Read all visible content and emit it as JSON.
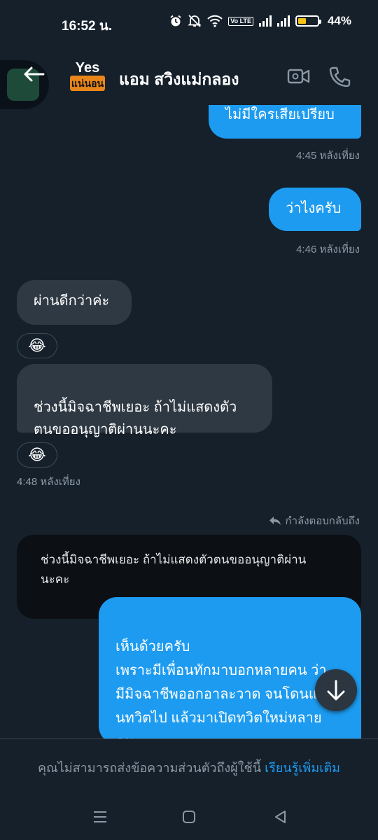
{
  "status": {
    "time": "16:52 น.",
    "battery_pct": "44%",
    "battery_level": 0.44,
    "volte_label": "Vo LTE",
    "icons": [
      "alarm-icon",
      "mute-icon",
      "wifi-icon",
      "volte-icon",
      "signal-icon",
      "signal-icon",
      "battery-icon"
    ]
  },
  "header": {
    "back_icon": "back-arrow-icon",
    "avatar_top": "Yes",
    "avatar_bottom": "แน่นอน",
    "name": "แอม สวิงแม่กลอง",
    "video_icon": "video-call-icon",
    "phone_icon": "phone-icon"
  },
  "messages": [
    {
      "dir": "out",
      "text": "ไม่มีใครเสียเปรียบ",
      "time": "4:45 หลังเที่ยง"
    },
    {
      "dir": "out",
      "text": "ว่าไงครับ",
      "time": "4:46 หลังเที่ยง"
    },
    {
      "dir": "in",
      "text": "ผ่านดีกว่าค่ะ",
      "reaction": "😂"
    },
    {
      "dir": "in",
      "text": "ช่วงนี้มิจฉาชีพเยอะ  ถ้าไม่แสดงตัว\nตนขออนุญาติผ่านนะคะ",
      "reaction": "😂",
      "time": "4:48 หลังเที่ยง"
    }
  ],
  "reply": {
    "label": "กำลังตอบกลับถึง",
    "quoted_text": "ช่วงนี้มิจฉาชีพเยอะ  ถ้าไม่แสดงตัวตนขออนุญาติผ่าน\nนะคะ",
    "message": "เห็นด้วยครับ\nเพราะมีเพื่อนทักมาบอกหลายคน ว่า\nมีมิจฉาชีพออกอาละวาด จนโดนแบ\nนทวิตไป แล้วมาเปิดทวิตใหม่หลาย\nคน"
  },
  "footer": {
    "notice": "คุณไม่สามารถส่งข้อความส่วนตัวถึงผู้ใช้นี้",
    "link": "เรียนรู้เพิ่มเติม"
  },
  "nav": {
    "icons": [
      "recents-icon",
      "home-icon",
      "back-icon"
    ]
  },
  "colors": {
    "background": "#15202b",
    "accent": "#1d9bf0",
    "incoming": "#2f3943",
    "muted": "#8b98a5"
  }
}
